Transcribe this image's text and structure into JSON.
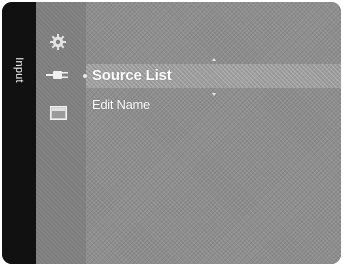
{
  "side_tab": {
    "label": "Input"
  },
  "icons": [
    {
      "name": "gear-icon"
    },
    {
      "name": "input-plug-icon"
    },
    {
      "name": "application-icon"
    }
  ],
  "menu": {
    "items": [
      {
        "label": "Source List",
        "selected": true
      },
      {
        "label": "Edit Name",
        "selected": false
      }
    ]
  },
  "colors": {
    "frame": "#1a1a1a",
    "panel": "#8e8e8e",
    "text": "#ffffff"
  }
}
